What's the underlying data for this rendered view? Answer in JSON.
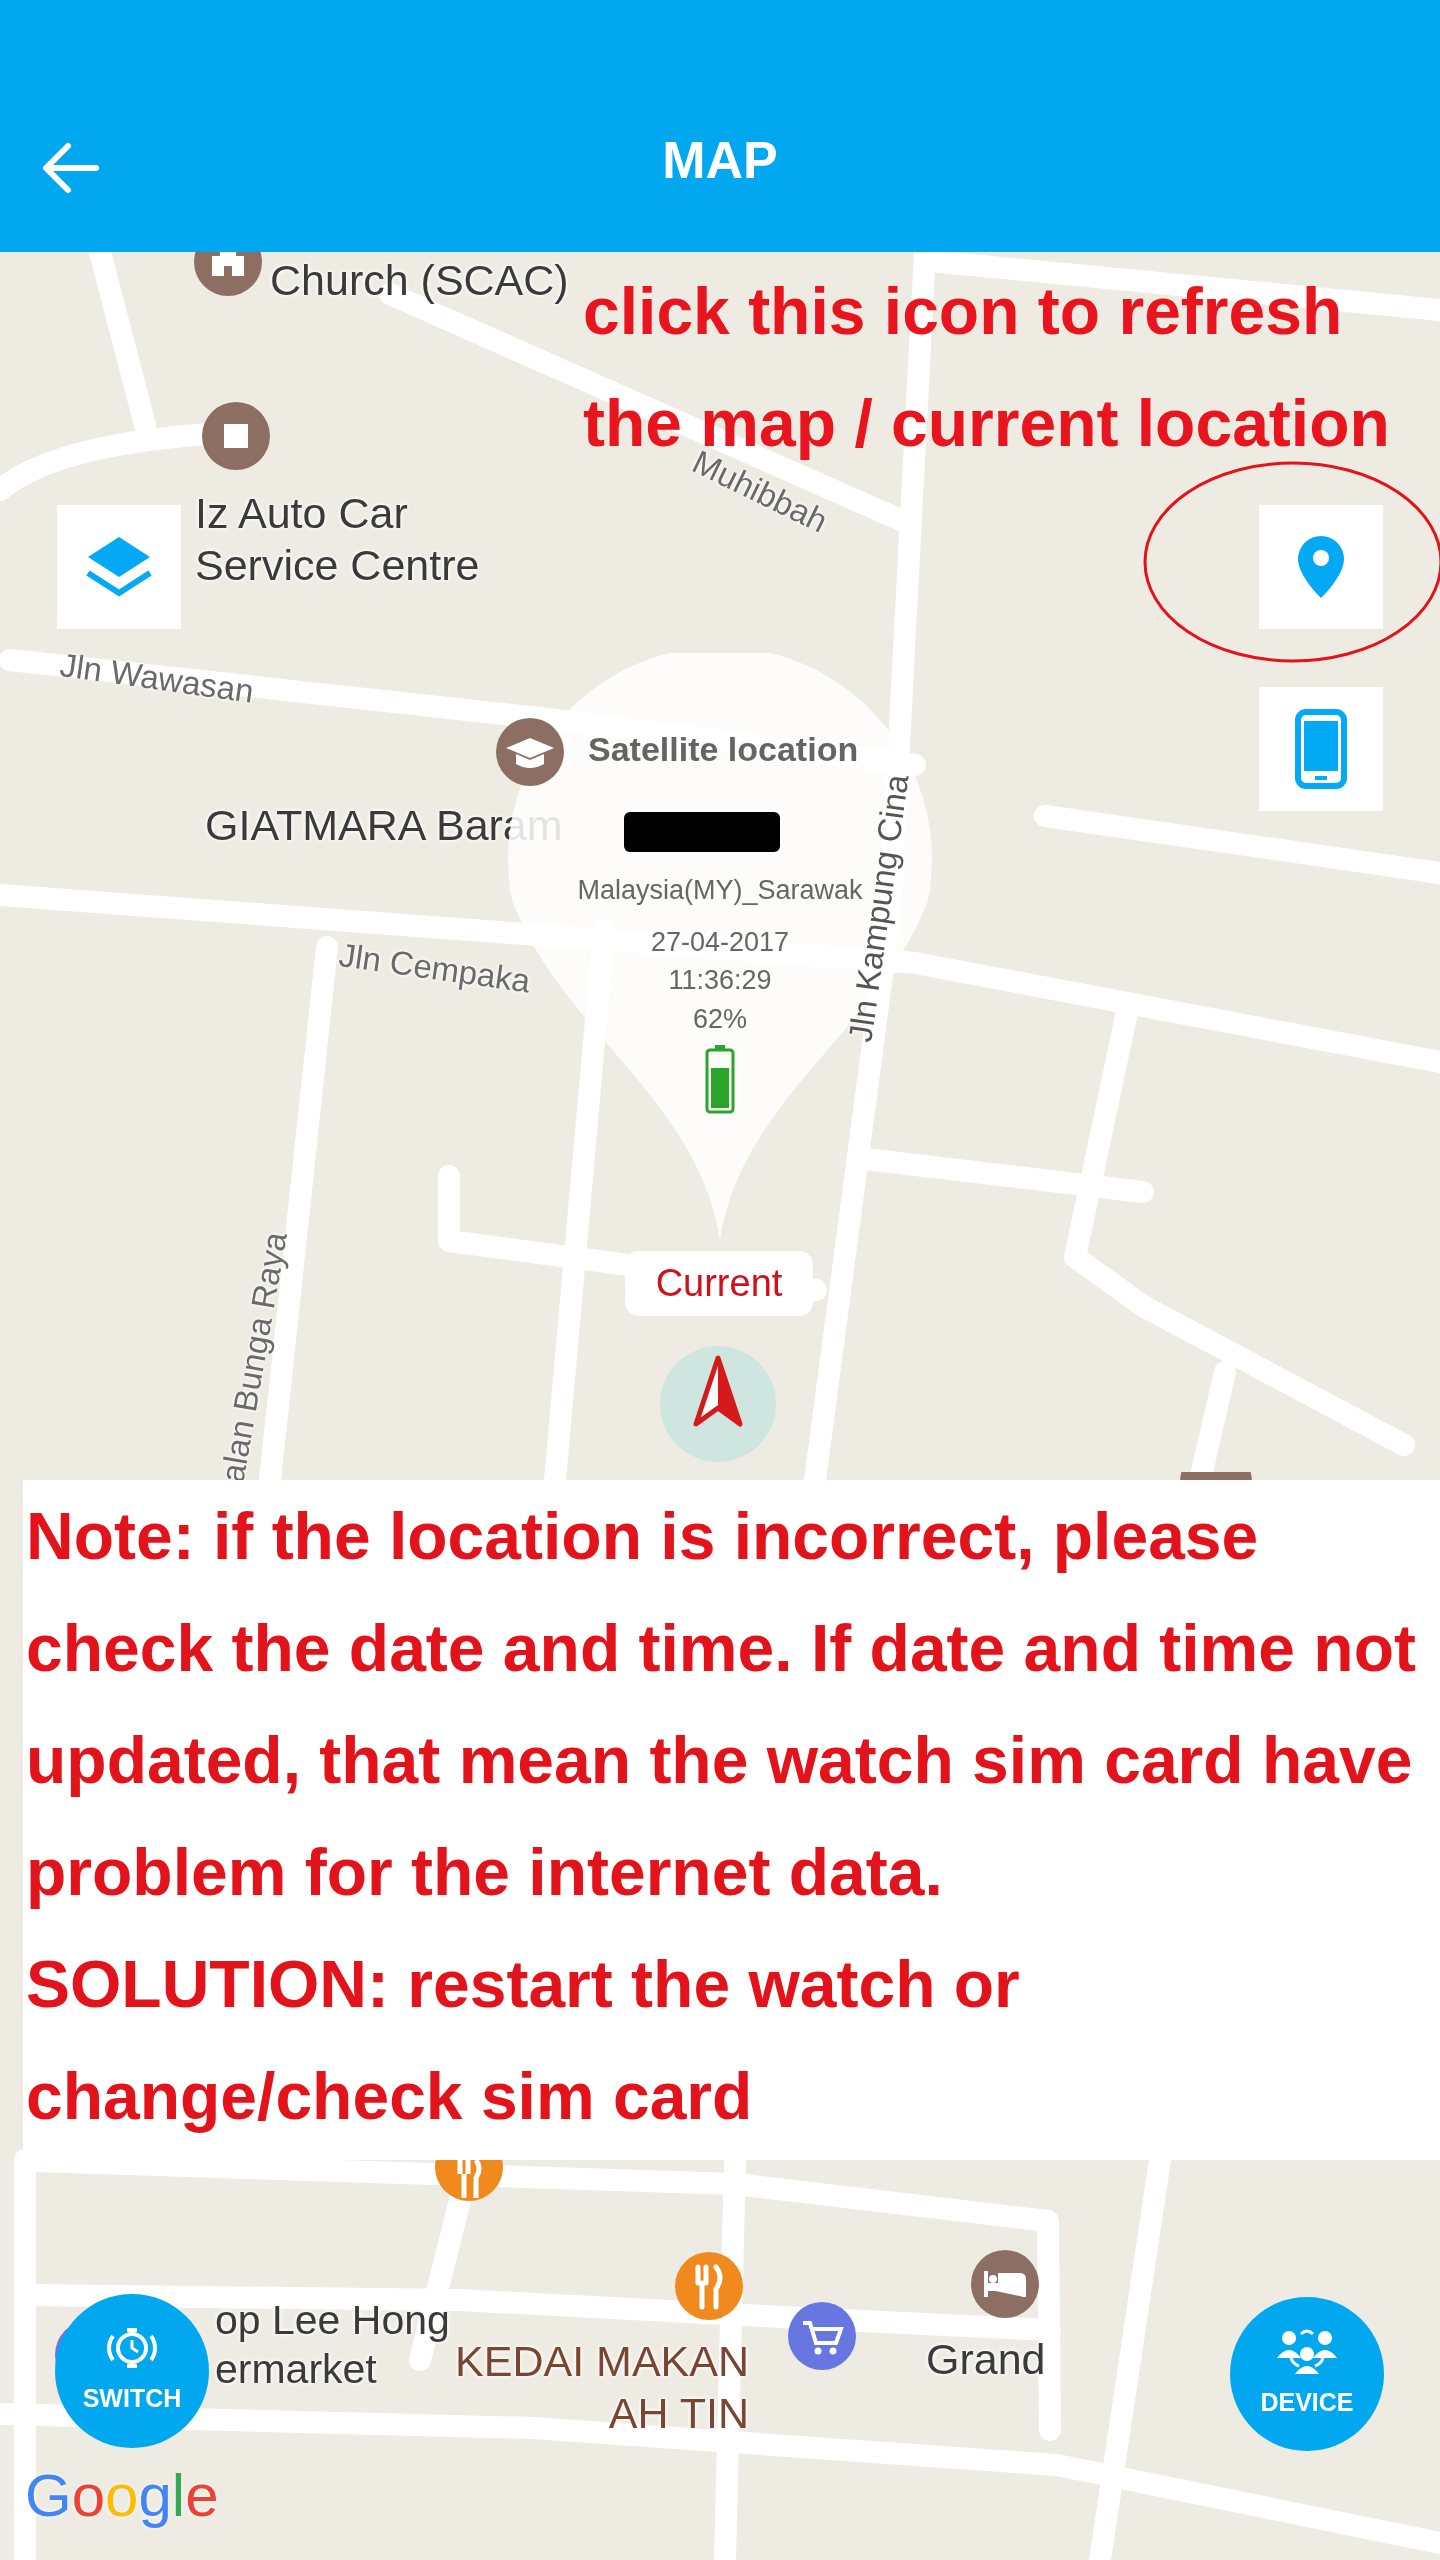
{
  "header": {
    "title": "MAP"
  },
  "map": {
    "labels": [
      {
        "kind": "place",
        "text": "Church (SCAC)"
      },
      {
        "kind": "street",
        "text": "Muhibbah"
      },
      {
        "kind": "place",
        "text": "Iz Auto Car Service Centre"
      },
      {
        "kind": "street",
        "text": "Jln Wawasan"
      },
      {
        "kind": "place",
        "text": "GIATMARA Baram"
      },
      {
        "kind": "street",
        "text": "Jln Cempaka"
      },
      {
        "kind": "street",
        "text": "Jln Kampung Cina"
      },
      {
        "kind": "street",
        "text": "alan Bunga Raya"
      },
      {
        "kind": "place",
        "text": "op Lee Hong ermarket"
      },
      {
        "kind": "business",
        "text": "KEDAI MAKAN AH TIN"
      },
      {
        "kind": "place",
        "text": "Grand"
      }
    ],
    "logo": "Google"
  },
  "popup": {
    "title": "Satellite location",
    "region": "Malaysia(MY)_Sarawak",
    "date": "27-04-2017",
    "time": "11:36:29",
    "battery": "62%"
  },
  "marker": {
    "label": "Current"
  },
  "annotation": {
    "text": "click this icon to refresh the map / current location"
  },
  "note": {
    "text": "Note: if the location is incorrect, please check the date and time. If date and time not updated, that mean the watch sim card have problem for the internet data.",
    "solution": "SOLUTION: restart the watch or change/check sim card"
  },
  "buttons": {
    "switch": "SWITCH",
    "device": "DEVICE"
  }
}
